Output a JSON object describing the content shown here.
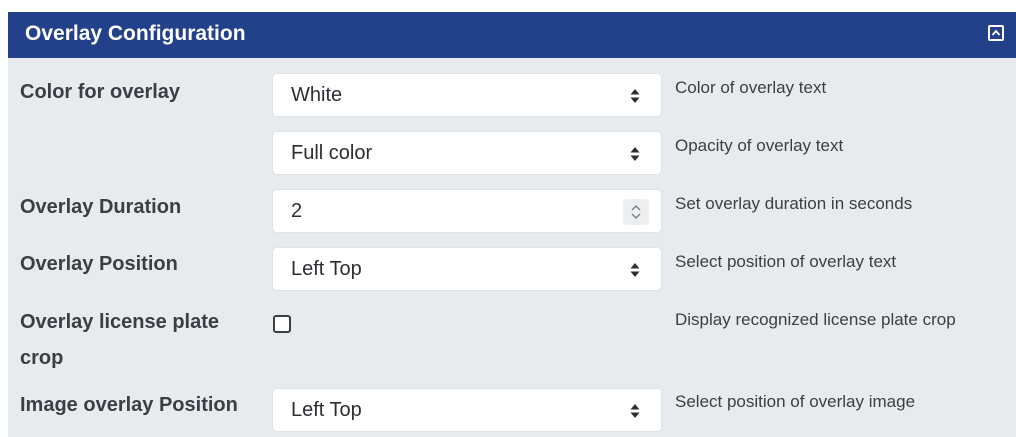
{
  "panel": {
    "title": "Overlay Configuration",
    "collapse_icon": "chevron-up-box-icon"
  },
  "rows": {
    "color": {
      "label": "Color for overlay",
      "value": "White",
      "description": "Color of overlay text"
    },
    "opacity": {
      "value": "Full color",
      "description": "Opacity of overlay text"
    },
    "duration": {
      "label": "Overlay Duration",
      "value": "2",
      "description": "Set overlay duration in seconds"
    },
    "position": {
      "label": "Overlay Position",
      "value": "Left Top",
      "description": "Select position of overlay text"
    },
    "license_crop": {
      "label_line1": "Overlay license plate",
      "label_line2": "crop",
      "checked": false,
      "description": "Display recognized license plate crop"
    },
    "image_position": {
      "label": "Image overlay Position",
      "value": "Left Top",
      "description": "Select position of overlay image"
    }
  },
  "colors": {
    "header_bg": "#23418a",
    "panel_bg": "#e8ebee",
    "text": "#3b3f45"
  }
}
